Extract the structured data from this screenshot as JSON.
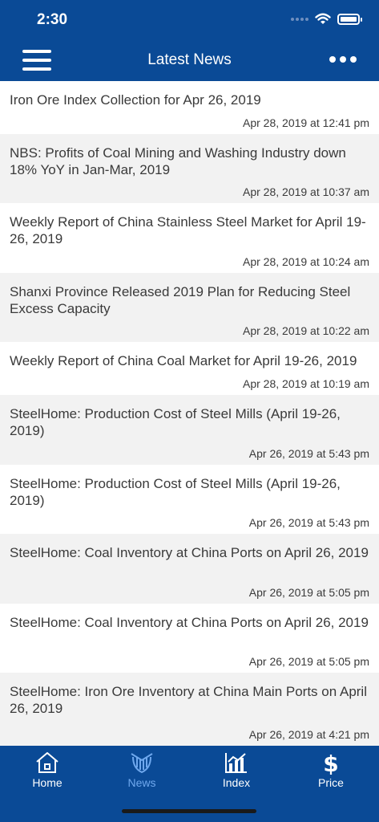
{
  "status": {
    "time": "2:30"
  },
  "nav": {
    "title": "Latest News"
  },
  "news": [
    {
      "title": "Iron Ore Index Collection for Apr 26, 2019",
      "date": "Apr 28, 2019 at 12:41 pm"
    },
    {
      "title": "NBS: Profits of Coal Mining and Washing Industry down 18% YoY in Jan-Mar, 2019",
      "date": "Apr 28, 2019 at 10:37 am"
    },
    {
      "title": "Weekly Report of China Stainless Steel Market for April 19-26, 2019",
      "date": "Apr 28, 2019 at 10:24 am"
    },
    {
      "title": "Shanxi Province Released 2019 Plan for Reducing Steel Excess Capacity",
      "date": "Apr 28, 2019 at 10:22 am"
    },
    {
      "title": "Weekly Report of China Coal Market for April 19-26, 2019",
      "date": "Apr 28, 2019 at 10:19 am"
    },
    {
      "title": "SteelHome: Production Cost of Steel Mills (April 19-26, 2019)",
      "date": "Apr 26, 2019 at 5:43 pm"
    },
    {
      "title": "SteelHome: Production Cost of Steel Mills (April 19-26, 2019)",
      "date": "Apr 26, 2019 at 5:43 pm"
    },
    {
      "title": "SteelHome: Coal Inventory at China Ports on April 26, 2019",
      "date": "Apr 26, 2019 at 5:05 pm"
    },
    {
      "title": "SteelHome: Coal Inventory at China Ports on April 26, 2019",
      "date": "Apr 26, 2019 at 5:05 pm"
    },
    {
      "title": "SteelHome: Iron Ore Inventory at China Main Ports on April 26, 2019",
      "date": "Apr 26, 2019 at 4:21 pm"
    }
  ],
  "tabs": [
    {
      "label": "Home",
      "icon": "home-icon"
    },
    {
      "label": "News",
      "icon": "news-icon"
    },
    {
      "label": "Index",
      "icon": "index-chart-icon"
    },
    {
      "label": "Price",
      "icon": "dollar-icon"
    }
  ],
  "colors": {
    "brand": "#0a4a96",
    "tab_active": "#6fa8ee",
    "row_alt": "#f2f2f2"
  }
}
